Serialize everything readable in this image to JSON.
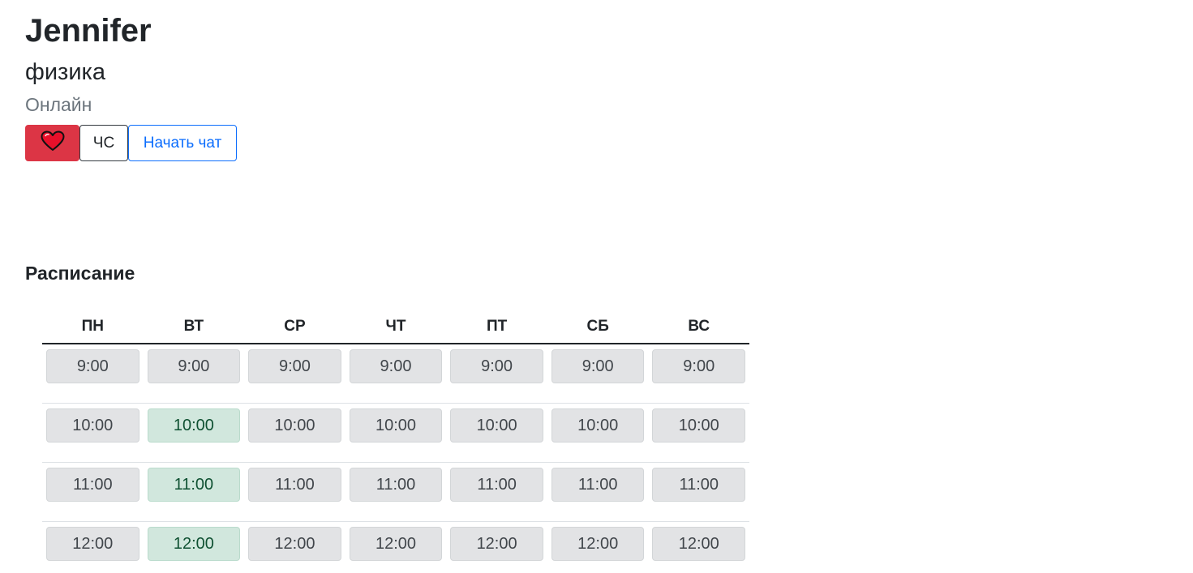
{
  "profile": {
    "name": "Jennifer",
    "subject": "физика",
    "status": "Онлайн"
  },
  "actions": {
    "like_icon": "heart-icon",
    "block_label": "ЧС",
    "chat_label": "Начать чат"
  },
  "schedule": {
    "title": "Расписание",
    "days": [
      "ПН",
      "ВТ",
      "СР",
      "ЧТ",
      "ПТ",
      "СБ",
      "ВС"
    ],
    "rows": [
      [
        "9:00",
        "9:00",
        "9:00",
        "9:00",
        "9:00",
        "9:00",
        "9:00"
      ],
      [
        "10:00",
        "10:00",
        "10:00",
        "10:00",
        "10:00",
        "10:00",
        "10:00"
      ],
      [
        "11:00",
        "11:00",
        "11:00",
        "11:00",
        "11:00",
        "11:00",
        "11:00"
      ],
      [
        "12:00",
        "12:00",
        "12:00",
        "12:00",
        "12:00",
        "12:00",
        "12:00"
      ]
    ],
    "booked": [
      [
        false,
        false,
        false,
        false,
        false,
        false,
        false
      ],
      [
        false,
        true,
        false,
        false,
        false,
        false,
        false
      ],
      [
        false,
        true,
        false,
        false,
        false,
        false,
        false
      ],
      [
        false,
        true,
        false,
        false,
        false,
        false,
        false
      ]
    ]
  },
  "colors": {
    "like": "#dc3545",
    "slot_default": "#e2e3e5",
    "slot_booked": "#d1e7dd",
    "chat_accent": "#0d6efd",
    "status_muted": "#6c757d"
  }
}
